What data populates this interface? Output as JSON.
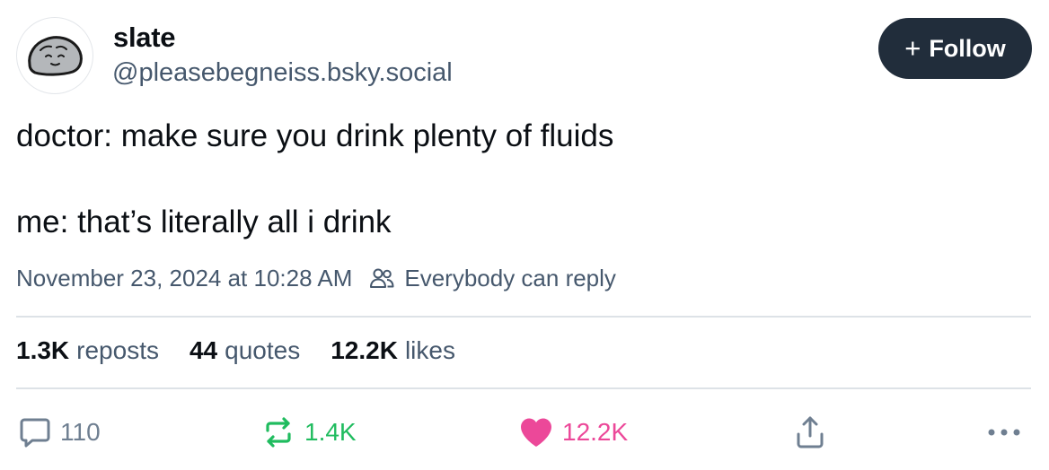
{
  "author": {
    "display_name": "slate",
    "handle": "@pleasebegneiss.bsky.social",
    "avatar_icon": "rock-face-icon"
  },
  "follow_button": {
    "plus": "+",
    "label": "Follow"
  },
  "post": {
    "lines": [
      "doctor: make sure you drink plenty of fluids",
      "me: that’s literally all i drink"
    ],
    "timestamp": "November 23, 2024 at 10:28 AM",
    "reply_scope": "Everybody can reply"
  },
  "stats": {
    "reposts": {
      "count": "1.3K",
      "label": "reposts"
    },
    "quotes": {
      "count": "44",
      "label": "quotes"
    },
    "likes": {
      "count": "12.2K",
      "label": "likes"
    }
  },
  "actions": {
    "reply_count": "110",
    "repost_count": "1.4K",
    "like_count": "12.2K"
  },
  "colors": {
    "follow_bg": "#212d3b",
    "repost_active": "#20bc5f",
    "like_active": "#ec4899",
    "muted_text": "#46586d"
  }
}
